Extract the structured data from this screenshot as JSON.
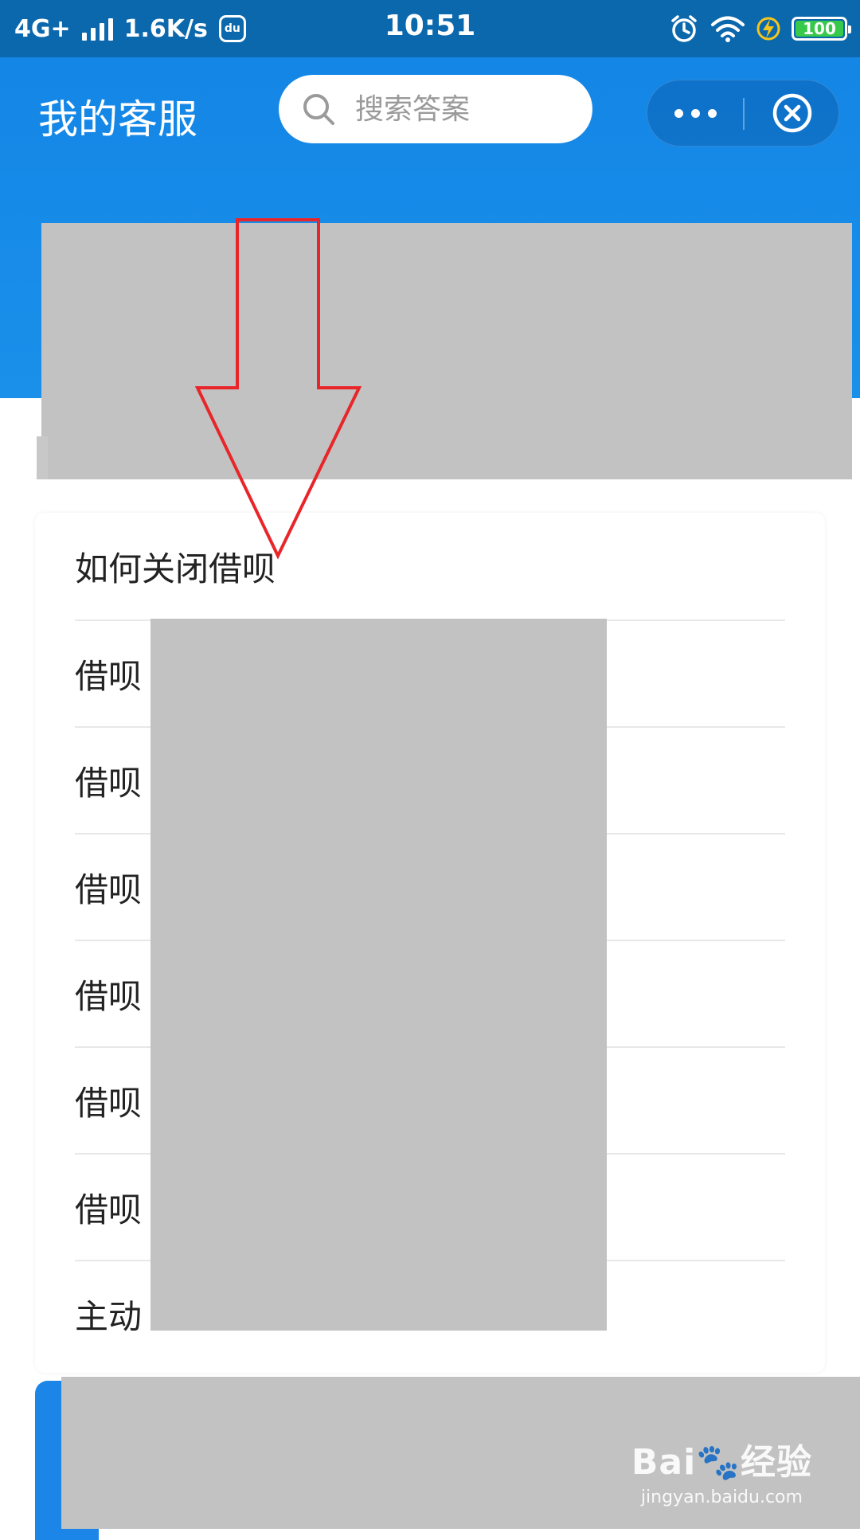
{
  "status_bar": {
    "network": "4G+",
    "speed": "1.6K/s",
    "time": "10:51",
    "battery": "100",
    "icons": [
      "signal-icon",
      "baidu-app-icon",
      "alarm-icon",
      "wifi-icon",
      "charging-icon",
      "battery-icon"
    ]
  },
  "header": {
    "title": "我的客服",
    "search_placeholder": "搜索答案"
  },
  "questions": [
    {
      "label": "如何关闭借呗"
    },
    {
      "label": "借呗"
    },
    {
      "label": "借呗"
    },
    {
      "label": "借呗"
    },
    {
      "label": "借呗"
    },
    {
      "label": "借呗"
    },
    {
      "label": "借呗"
    },
    {
      "label": "主动"
    }
  ],
  "watermark": {
    "main": "Bai",
    "brand_suffix": "经验",
    "sub": "jingyan.baidu.com"
  },
  "colors": {
    "header": "#1486e6",
    "status_bar": "#0b68ad",
    "annotation": "#e8262a",
    "redaction": "#c2c2c2"
  }
}
